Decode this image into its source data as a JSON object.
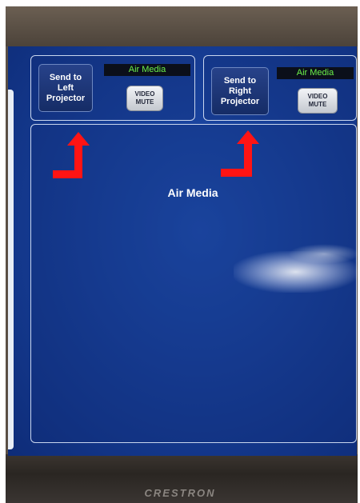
{
  "device": {
    "brand": "CRESTRON"
  },
  "outputs": {
    "left": {
      "send_label": "Send to\nLeft\nProjector",
      "source_label": "Air Media",
      "mute_label": "VIDEO\nMUTE"
    },
    "right": {
      "send_label": "Send to\nRight\nProjector",
      "source_label": "Air Media",
      "mute_label": "VIDEO\nMUTE"
    }
  },
  "main": {
    "title": "Air Media"
  },
  "colors": {
    "screen_blue": "#173f98",
    "source_label_green": "#6cf24a",
    "arrow_red": "#ff1414"
  },
  "annotations": [
    {
      "icon": "arrow-up-icon",
      "points_to": "send-left-button"
    },
    {
      "icon": "arrow-up-icon",
      "points_to": "send-right-button"
    }
  ]
}
